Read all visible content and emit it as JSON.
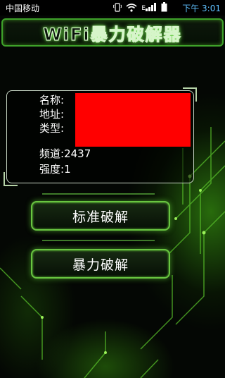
{
  "status_bar": {
    "carrier": "中国移动",
    "time_period": "下午",
    "time": "3:01",
    "network_type": "E",
    "icons": [
      "vibrate-icon",
      "wifi-icon",
      "signal-icon",
      "battery-icon"
    ]
  },
  "header": {
    "title": "WiFi暴力破解器"
  },
  "network_info": {
    "name_label": "名称:",
    "address_label": "地址:",
    "type_label": "类型:",
    "channel_label": "频道:",
    "channel_value": "2437",
    "strength_label": "强度:",
    "strength_value": "1"
  },
  "buttons": {
    "standard_crack": "标准破解",
    "brute_force_crack": "暴力破解"
  },
  "colors": {
    "accent_green": "#69c541",
    "redaction": "#ff0000",
    "time_blue": "#5fc0ff"
  }
}
